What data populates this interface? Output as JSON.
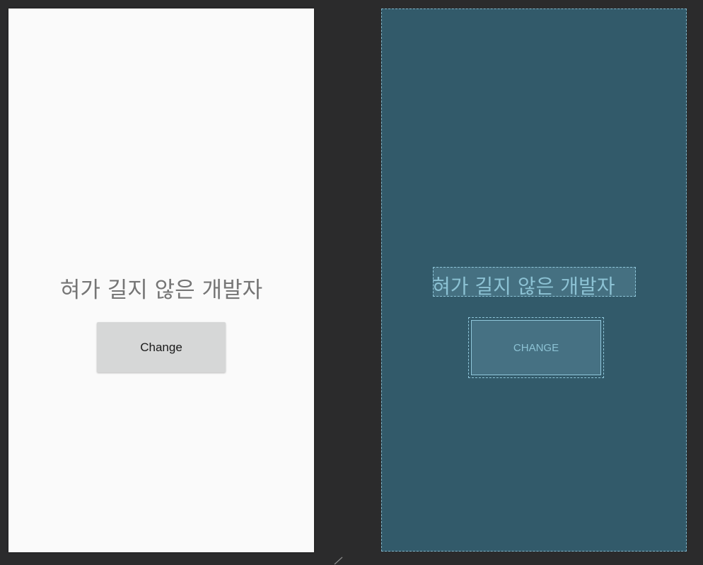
{
  "design_view": {
    "title_text": "혀가 길지 않은 개발자",
    "button_label": "Change"
  },
  "blueprint_view": {
    "title_text": "혀가 길지 않은 개발자",
    "button_label": "CHANGE"
  },
  "colors": {
    "editor_background": "#2b2b2c",
    "design_background": "#fafafa",
    "design_text": "#757575",
    "design_button": "#d6d7d7",
    "blueprint_background": "#325a6a",
    "blueprint_outline": "#8fc6da"
  },
  "icons": {
    "resize_handle": "resize-handle-icon"
  }
}
